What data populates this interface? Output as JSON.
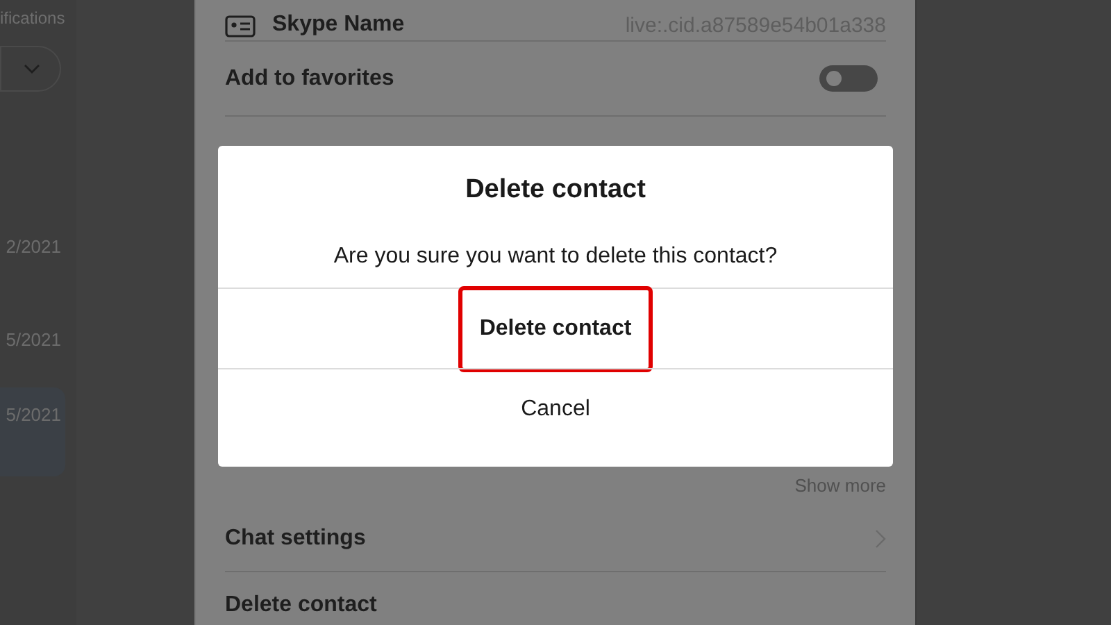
{
  "sidebar": {
    "subtitle": "ifications",
    "dates": [
      {
        "text": "2/2021",
        "selected": false
      },
      {
        "text": "5/2021",
        "selected": false
      },
      {
        "text": "5/2021",
        "selected": true
      }
    ]
  },
  "profile": {
    "skype_name": {
      "label": "Skype Name",
      "value": "live:.cid.a87589e54b01a338"
    },
    "favorites": {
      "label": "Add to favorites",
      "on": false
    },
    "show_more": "Show more",
    "rows": [
      {
        "label": "Chat settings",
        "kind": "link"
      },
      {
        "label": "Delete contact",
        "kind": "plain"
      }
    ]
  },
  "dialog": {
    "title": "Delete contact",
    "message": "Are you sure you want to delete this contact?",
    "buttons": [
      {
        "label": "Delete contact",
        "kind": "primary",
        "highlighted": true
      },
      {
        "label": "Cancel",
        "kind": "secondary",
        "highlighted": false
      }
    ]
  }
}
